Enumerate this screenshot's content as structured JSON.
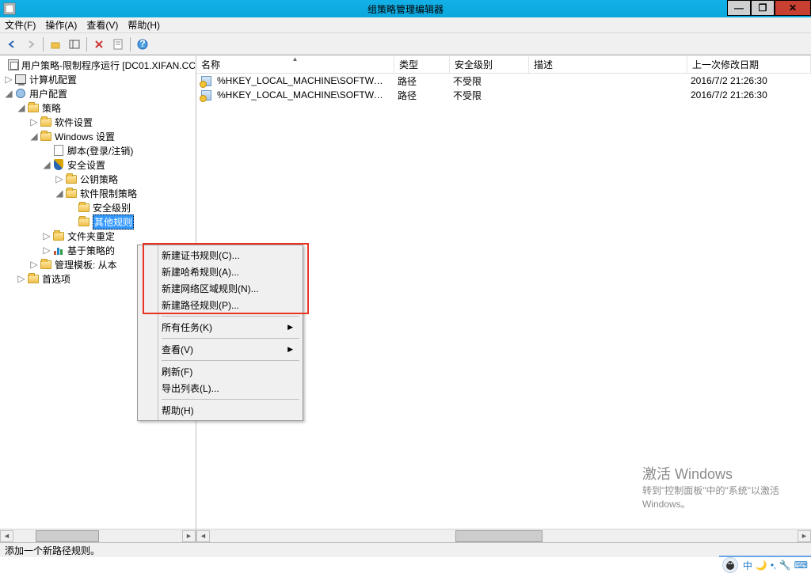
{
  "window": {
    "title": "组策略管理编辑器"
  },
  "menubar": {
    "file": "文件(F)",
    "action": "操作(A)",
    "view": "查看(V)",
    "help": "帮助(H)"
  },
  "tree": {
    "root": "用户策略-限制程序运行 [DC01.XIFAN.CC",
    "computer_config": "计算机配置",
    "user_config": "用户配置",
    "policy": "策略",
    "software_settings": "软件设置",
    "windows_settings": "Windows 设置",
    "scripts": "脚本(登录/注销)",
    "security_settings": "安全设置",
    "pubkey_policy": "公钥策略",
    "software_restriction": "软件限制策略",
    "security_level": "安全级别",
    "other_rules": "其他规则",
    "folder_redirect": "文件夹重定",
    "policy_based": "基于策略的",
    "admin_templates": "管理模板: 从本",
    "preferences": "首选项"
  },
  "columns": {
    "name": "名称",
    "type": "类型",
    "security": "安全级别",
    "desc": "描述",
    "modified": "上一次修改日期",
    "w_name": 250,
    "w_type": 70,
    "w_sec": 100,
    "w_desc": 200,
    "w_mod": 140
  },
  "rows": [
    {
      "name": "%HKEY_LOCAL_MACHINE\\SOFTWAR...",
      "type": "路径",
      "sec": "不受限",
      "desc": "",
      "mod": "2016/7/2  21:26:30"
    },
    {
      "name": "%HKEY_LOCAL_MACHINE\\SOFTWAR...",
      "type": "路径",
      "sec": "不受限",
      "desc": "",
      "mod": "2016/7/2  21:26:30"
    }
  ],
  "context_menu": {
    "cert_rule": "新建证书规则(C)...",
    "hash_rule": "新建哈希规则(A)...",
    "zone_rule": "新建网络区域规则(N)...",
    "path_rule": "新建路径规则(P)...",
    "all_tasks": "所有任务(K)",
    "view": "查看(V)",
    "refresh": "刷新(F)",
    "export": "导出列表(L)...",
    "help": "帮助(H)"
  },
  "statusbar": {
    "text": "添加一个新路径规则。"
  },
  "watermark": {
    "l1": "激活 Windows",
    "l2": "转到\"控制面板\"中的\"系统\"以激活",
    "l3": "Windows。"
  },
  "ime": {
    "lang": "中"
  }
}
